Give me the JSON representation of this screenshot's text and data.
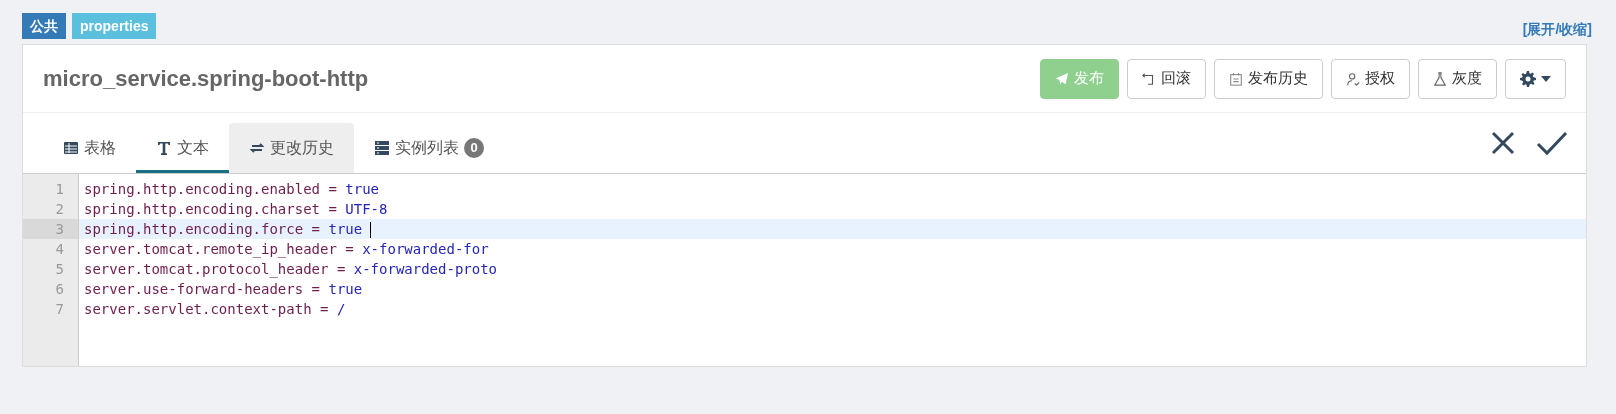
{
  "badges": [
    {
      "label": "公共",
      "color": "#337ab7"
    },
    {
      "label": "properties",
      "color": "#5bc0de"
    }
  ],
  "toggle_link": "[展开/收缩]",
  "namespace_title": "micro_service.spring-boot-http",
  "actions": [
    {
      "kind": "publish",
      "label": "发布",
      "disabled": true
    },
    {
      "kind": "rollback",
      "label": "回滚",
      "disabled": false
    },
    {
      "kind": "history",
      "label": "发布历史",
      "disabled": false
    },
    {
      "kind": "auth",
      "label": "授权",
      "disabled": false
    },
    {
      "kind": "gray",
      "label": "灰度",
      "disabled": false
    },
    {
      "kind": "settings",
      "disabled": false
    }
  ],
  "tabs": [
    {
      "kind": "table",
      "label": "表格",
      "selected": false,
      "hover": false
    },
    {
      "kind": "text",
      "label": "文本",
      "selected": true,
      "hover": false
    },
    {
      "kind": "history",
      "label": "更改历史",
      "selected": false,
      "hover": true
    },
    {
      "kind": "instances",
      "label": "实例列表",
      "count": "0",
      "selected": false,
      "hover": false
    }
  ],
  "editor": {
    "lines": [
      {
        "number": "1",
        "key": "spring.http.encoding.enabled",
        "operator": "=",
        "value": "true",
        "active": false
      },
      {
        "number": "2",
        "key": "spring.http.encoding.charset",
        "operator": "=",
        "value": "UTF-8",
        "active": false
      },
      {
        "number": "3",
        "key": "spring.http.encoding.force",
        "operator": "=",
        "value": "true",
        "active": true
      },
      {
        "number": "4",
        "key": "server.tomcat.remote_ip_header",
        "operator": "=",
        "value": "x-forwarded-for",
        "active": false
      },
      {
        "number": "5",
        "key": "server.tomcat.protocol_header",
        "operator": "=",
        "value": "x-forwarded-proto",
        "active": false
      },
      {
        "number": "6",
        "key": "server.use-forward-headers",
        "operator": "=",
        "value": "true",
        "active": false
      },
      {
        "number": "7",
        "key": "server.servlet.context-path",
        "operator": "=",
        "value": "/",
        "active": false
      }
    ]
  }
}
